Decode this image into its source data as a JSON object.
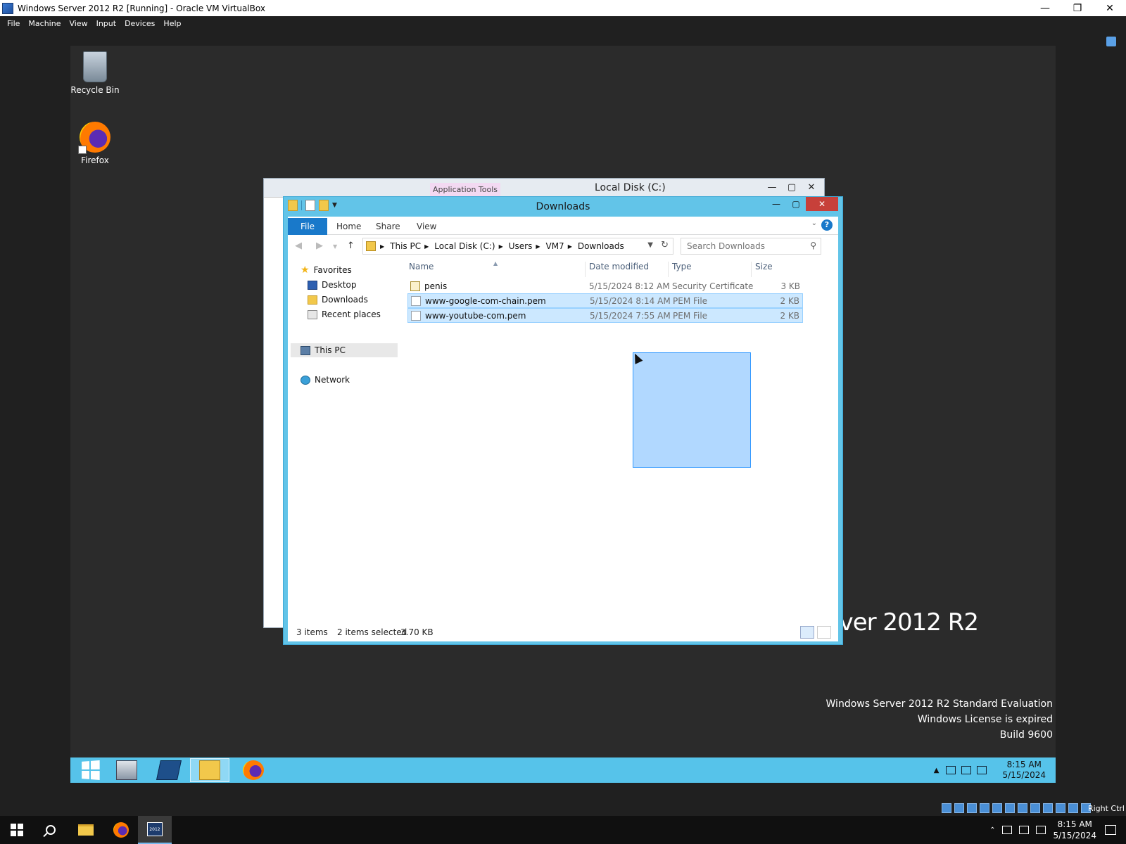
{
  "host": {
    "title": "Windows Server 2012 R2 [Running] - Oracle VM VirtualBox",
    "menu": [
      "File",
      "Machine",
      "View",
      "Input",
      "Devices",
      "Help"
    ],
    "host_key_label": "Right Ctrl",
    "taskbar": {
      "time": "8:15 AM",
      "date": "5/15/2024"
    }
  },
  "desktop": {
    "icons": [
      {
        "label": "Recycle Bin",
        "icon": "recycle-bin-icon"
      },
      {
        "label": "Firefox",
        "icon": "firefox-icon"
      }
    ],
    "branding": "erver 2012 R2",
    "watermark": {
      "line1": "Windows Server 2012 R2 Standard Evaluation",
      "line2": "Windows License is expired",
      "line3": "Build 9600"
    }
  },
  "back_window": {
    "title": "Local Disk (C:)",
    "context_tab": "Application Tools"
  },
  "explorer": {
    "title": "Downloads",
    "ribbon": {
      "file": "File",
      "home": "Home",
      "share": "Share",
      "view": "View"
    },
    "address": {
      "crumbs": [
        "This PC",
        "Local Disk (C:)",
        "Users",
        "VM7",
        "Downloads"
      ]
    },
    "search_placeholder": "Search Downloads",
    "nav": {
      "favorites": "Favorites",
      "desktop": "Desktop",
      "downloads": "Downloads",
      "recent": "Recent places",
      "this_pc": "This PC",
      "network": "Network"
    },
    "columns": {
      "name": "Name",
      "date": "Date modified",
      "type": "Type",
      "size": "Size"
    },
    "files": [
      {
        "name": "penis",
        "date": "5/15/2024 8:12 AM",
        "type": "Security Certificate",
        "size": "3 KB",
        "selected": false
      },
      {
        "name": "www-google-com-chain.pem",
        "date": "5/15/2024 8:14 AM",
        "type": "PEM File",
        "size": "2 KB",
        "selected": true
      },
      {
        "name": "www-youtube-com.pem",
        "date": "5/15/2024 7:55 AM",
        "type": "PEM File",
        "size": "2 KB",
        "selected": true
      }
    ],
    "status": {
      "items": "3 items",
      "selected": "2 items selected",
      "size": "3.70 KB"
    }
  },
  "guest_taskbar": {
    "time": "8:15 AM",
    "date": "5/15/2024"
  }
}
